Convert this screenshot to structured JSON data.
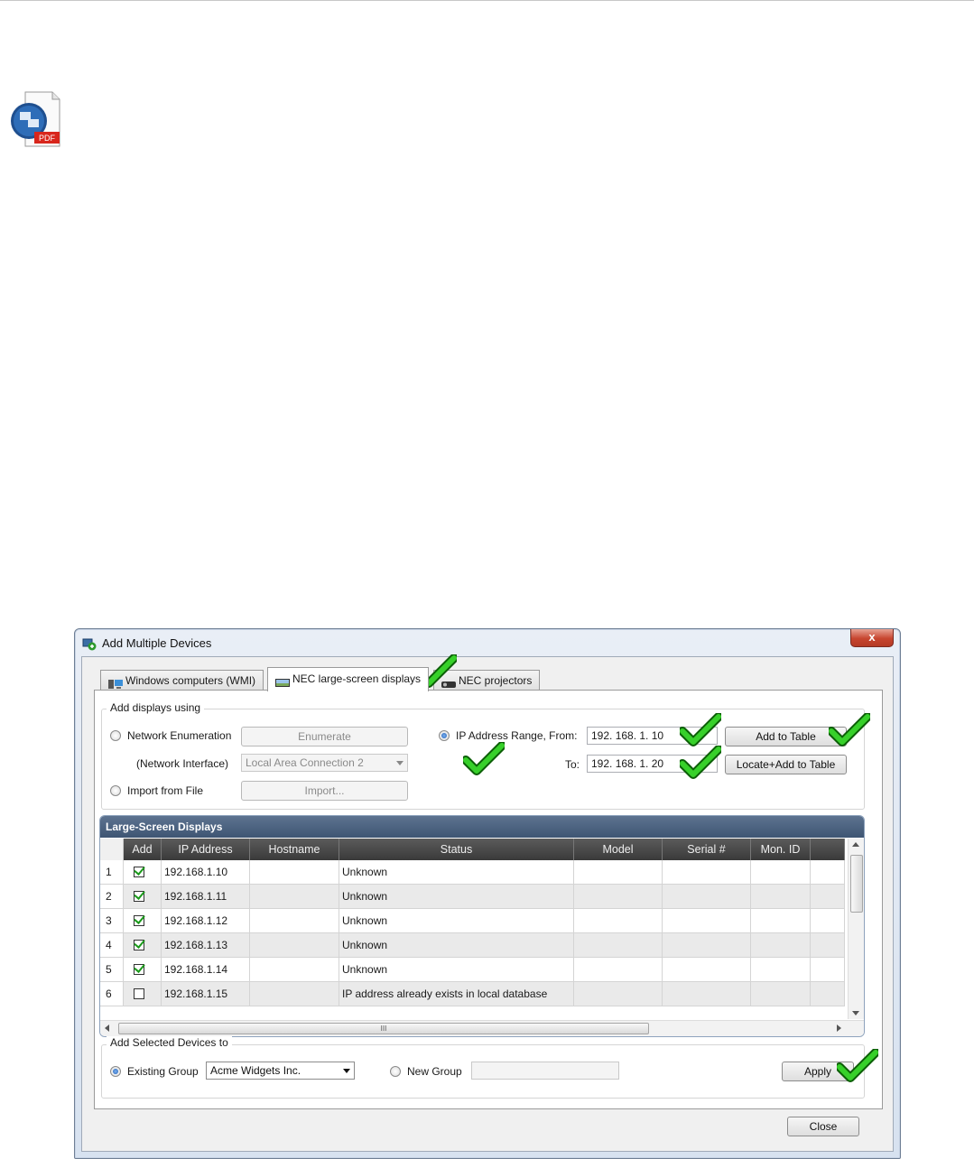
{
  "pdf_icon": {
    "label": "PDF"
  },
  "dialog": {
    "title": "Add Multiple Devices",
    "close_glyph": "x",
    "tabs": [
      {
        "label": "Windows computers (WMI)",
        "active": false
      },
      {
        "label": "NEC large-screen displays",
        "active": true
      },
      {
        "label": "NEC projectors",
        "active": false
      }
    ],
    "add_displays": {
      "legend": "Add displays using",
      "network_enumeration": "Network Enumeration",
      "enumerate_button": "Enumerate",
      "network_interface_label": "(Network Interface)",
      "network_interface_value": "Local Area Connection 2",
      "import_from_file": "Import from File",
      "import_button": "Import...",
      "ip_range_label": "IP Address Range, From:",
      "from_value": "192. 168. 1. 10",
      "to_label": "To:",
      "to_value": "192. 168. 1. 20",
      "add_to_table": "Add to Table",
      "locate_add": "Locate+Add to Table",
      "selected_mode": "ip_range"
    },
    "grid": {
      "title": "Large-Screen Displays",
      "columns": [
        "Add",
        "IP Address",
        "Hostname",
        "Status",
        "Model",
        "Serial #",
        "Mon. ID"
      ],
      "rows": [
        {
          "n": "1",
          "checked": true,
          "ip": "192.168.1.10",
          "hostname": "",
          "status": "Unknown"
        },
        {
          "n": "2",
          "checked": true,
          "ip": "192.168.1.11",
          "hostname": "",
          "status": "Unknown"
        },
        {
          "n": "3",
          "checked": true,
          "ip": "192.168.1.12",
          "hostname": "",
          "status": "Unknown"
        },
        {
          "n": "4",
          "checked": true,
          "ip": "192.168.1.13",
          "hostname": "",
          "status": "Unknown"
        },
        {
          "n": "5",
          "checked": true,
          "ip": "192.168.1.14",
          "hostname": "",
          "status": "Unknown"
        },
        {
          "n": "6",
          "checked": false,
          "ip": "192.168.1.15",
          "hostname": "",
          "status": "IP address already exists in local database"
        }
      ],
      "hscroll_grip": "III"
    },
    "add_selected": {
      "legend": "Add Selected Devices to",
      "existing_group": "Existing Group",
      "existing_group_value": "Acme Widgets Inc.",
      "new_group": "New Group",
      "new_group_value": "",
      "apply": "Apply",
      "selected_mode": "existing"
    },
    "close_button": "Close"
  },
  "colors": {
    "tick_green": "#37d02a",
    "grid_header": "#4b6280",
    "close_red": "#c7452f"
  }
}
